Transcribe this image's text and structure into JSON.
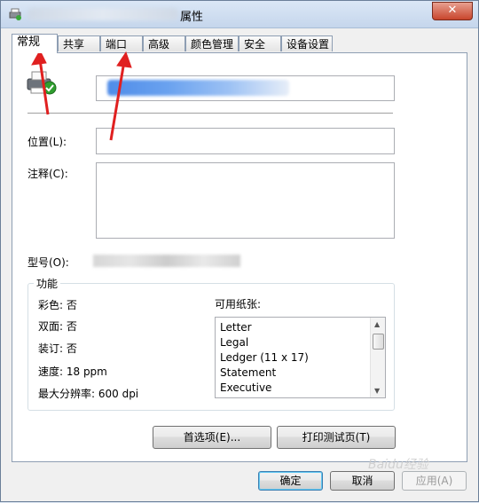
{
  "window": {
    "title_suffix": "属性",
    "close_label": "✕"
  },
  "tabs": [
    {
      "label": "常规"
    },
    {
      "label": "共享"
    },
    {
      "label": "端口"
    },
    {
      "label": "高级"
    },
    {
      "label": "颜色管理"
    },
    {
      "label": "安全"
    },
    {
      "label": "设备设置"
    }
  ],
  "general": {
    "location_label": "位置(L):",
    "location_value": "",
    "comment_label": "注释(C):",
    "comment_value": "",
    "model_label": "型号(O):"
  },
  "features": {
    "legend": "功能",
    "color": "彩色: 否",
    "duplex": "双面: 否",
    "staple": "装订: 否",
    "speed": "速度: 18 ppm",
    "max_resolution": "最大分辨率: 600 dpi",
    "paper_label": "可用纸张:",
    "paper_sizes": [
      "Letter",
      "Legal",
      "Ledger (11 x 17)",
      "Statement",
      "Executive"
    ]
  },
  "buttons": {
    "preferences": "首选项(E)...",
    "print_test": "打印测试页(T)",
    "ok": "确定",
    "cancel": "取消",
    "apply": "应用(A)"
  },
  "watermark": "Baidu经验",
  "colors": {
    "annotation_arrow": "#e02020",
    "accent": "#3c7fb1"
  }
}
